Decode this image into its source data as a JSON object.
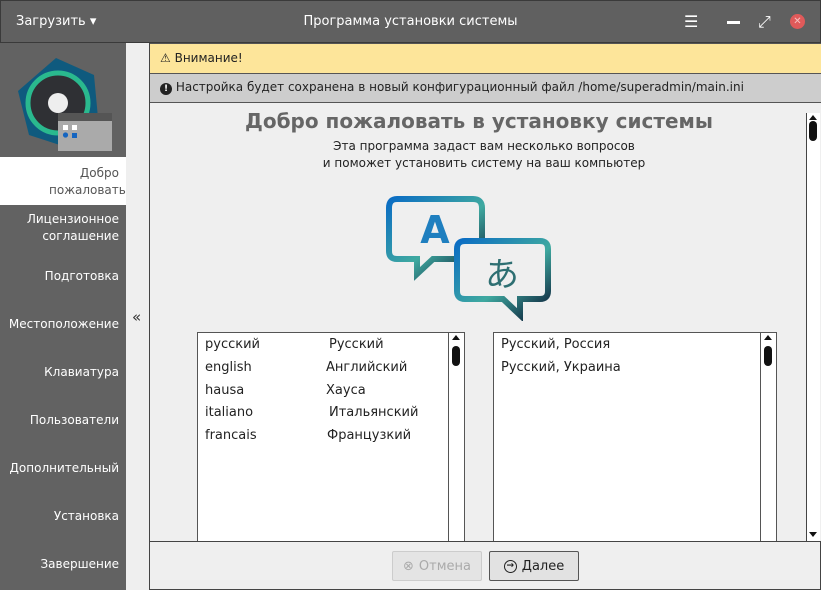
{
  "titlebar": {
    "load_label": "Загрузить",
    "title": "Программа установки системы"
  },
  "sidebar": {
    "items": [
      {
        "label": "Добро пожаловать",
        "selected": true
      },
      {
        "label": "Лицензионное соглашение"
      },
      {
        "label": "Подготовка"
      },
      {
        "label": "Местоположение"
      },
      {
        "label": "Клавиатура"
      },
      {
        "label": "Пользователи"
      },
      {
        "label": "Дополнительный"
      },
      {
        "label": "Установка"
      },
      {
        "label": "Завершение"
      }
    ]
  },
  "collapse_label": "«",
  "warning": "Внимание!",
  "info": "Настройка будет сохранена в новый конфигурационный файл /home/superadmin/main.ini",
  "content": {
    "heading": "Добро пожаловать в установку системы",
    "sub1": "Эта программа задаст вам несколько вопросов",
    "sub2": "и поможет установить систему на ваш компьютер"
  },
  "languages": [
    {
      "code": "русский",
      "name": "Русский"
    },
    {
      "code": "english",
      "name": "Английский"
    },
    {
      "code": "hausa",
      "name": "Хауса"
    },
    {
      "code": "italiano",
      "name": "Итальянский"
    },
    {
      "code": "francais",
      "name": "Французкий"
    }
  ],
  "locales": [
    "Русский, Россия",
    "Русский, Украина"
  ],
  "footer": {
    "cancel": "Отмена",
    "next": "Далее"
  }
}
